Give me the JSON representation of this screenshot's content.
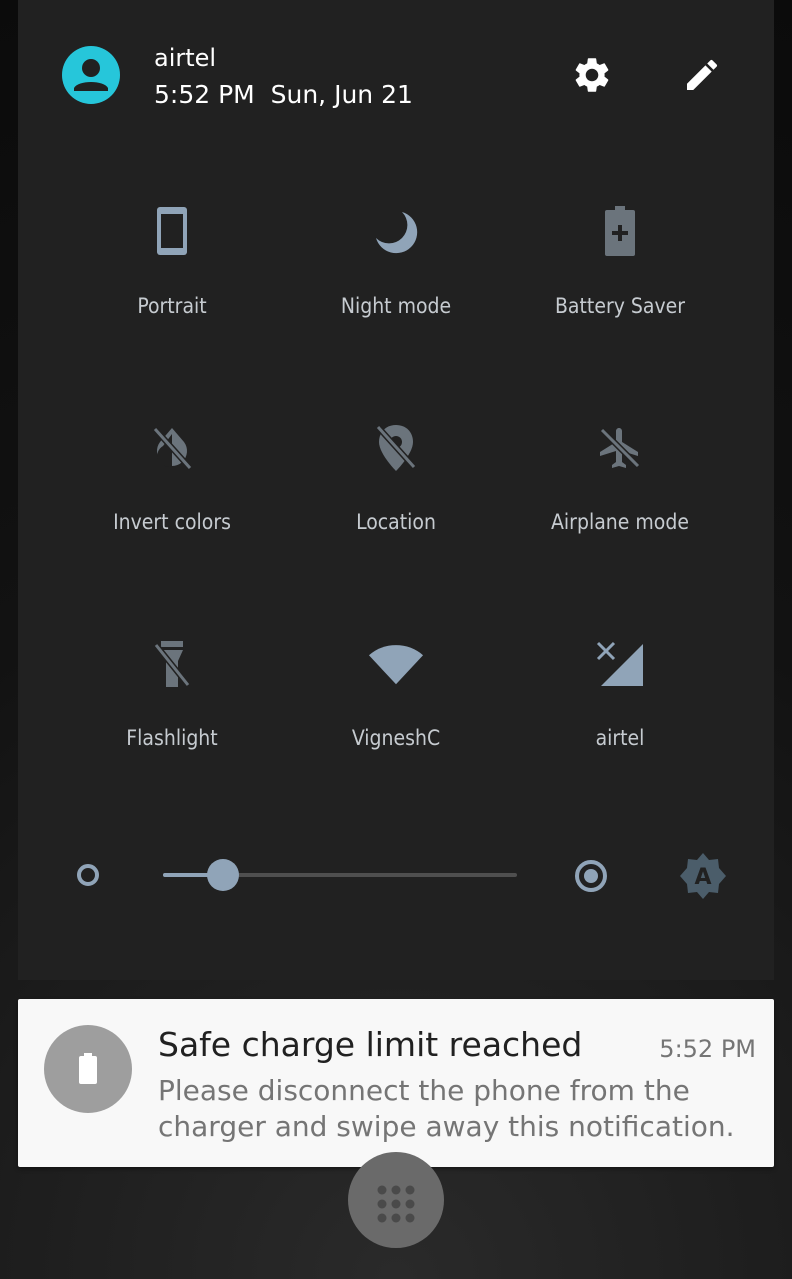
{
  "header": {
    "carrier": "airtel",
    "datetime": "5:52 PM  Sun, Jun 21",
    "avatar_icon": "account-circle-icon",
    "settings_icon": "gear-icon",
    "edit_icon": "pencil-icon"
  },
  "tiles": [
    {
      "label": "Portrait",
      "icon": "phone-portrait-icon"
    },
    {
      "label": "Night mode",
      "icon": "moon-icon"
    },
    {
      "label": "Battery Saver",
      "icon": "battery-plus-icon"
    },
    {
      "label": "Invert colors",
      "icon": "invert-colors-off-icon"
    },
    {
      "label": "Location",
      "icon": "location-off-icon"
    },
    {
      "label": "Airplane mode",
      "icon": "airplane-off-icon"
    },
    {
      "label": "Flashlight",
      "icon": "flashlight-off-icon"
    },
    {
      "label": "VigneshC",
      "icon": "wifi-icon"
    },
    {
      "label": "airtel",
      "icon": "cell-signal-no-data-icon"
    }
  ],
  "brightness": {
    "level": 0.17,
    "low_icon": "brightness-low-icon",
    "high_icon": "brightness-high-icon",
    "auto_icon": "brightness-auto-icon"
  },
  "notification": {
    "title": "Safe charge limit reached",
    "time": "5:52 PM",
    "body": "Please disconnect the phone from the charger and swipe away this notification.",
    "icon": "battery-icon"
  },
  "launcher": {
    "icon": "app-drawer-icon"
  },
  "colors": {
    "panel_bg": "#212121",
    "accent": "#26c6da",
    "tile_icon": "#90a4b8",
    "tile_icon_off": "#6b747c",
    "notification_bg": "#f8f8f8"
  }
}
